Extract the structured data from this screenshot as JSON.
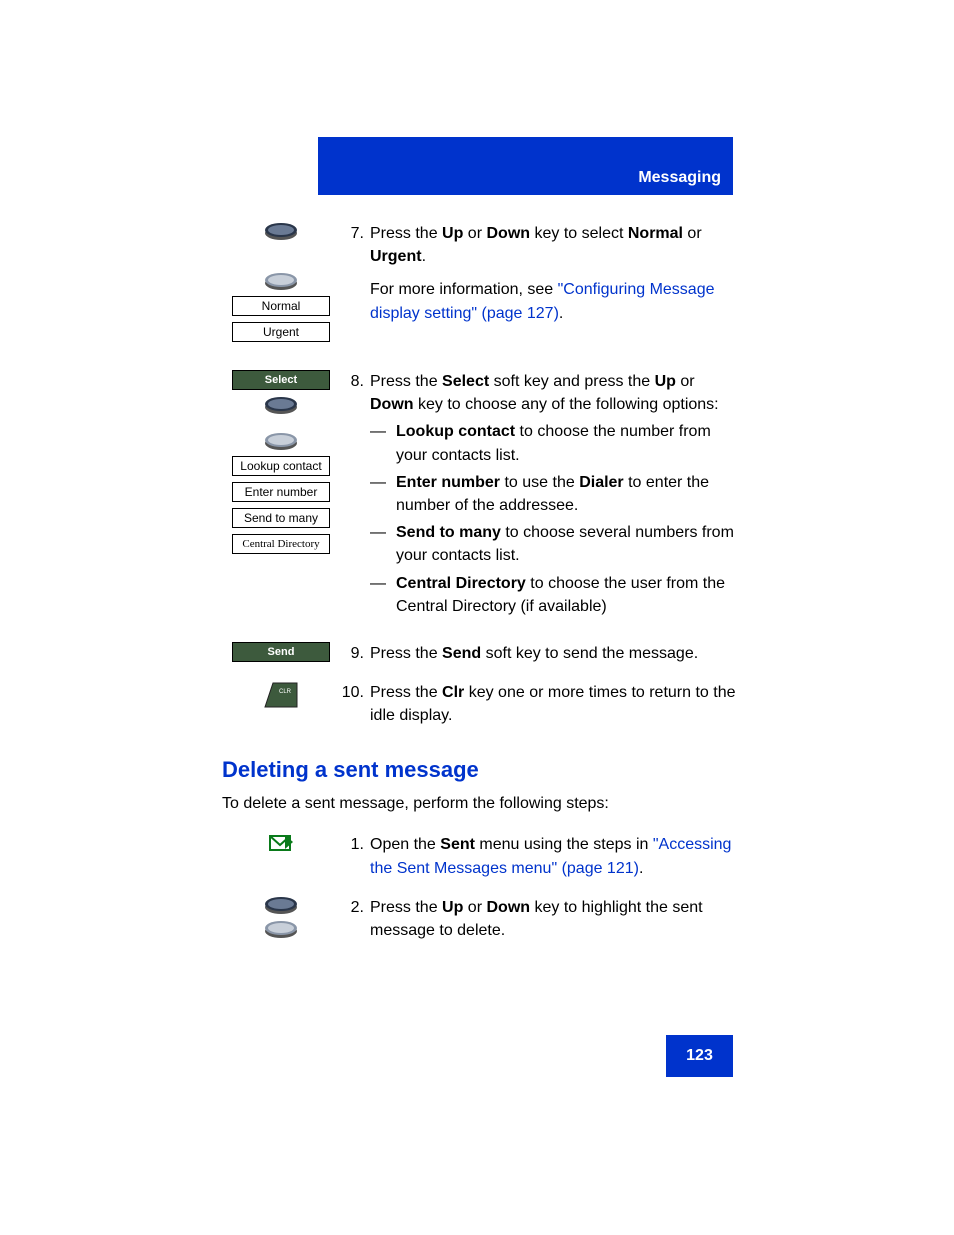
{
  "header": {
    "title": "Messaging"
  },
  "step7": {
    "num": "7.",
    "text_a": "Press the ",
    "up": "Up",
    "text_b": " or ",
    "down": "Down",
    "text_c": " key to select ",
    "normal": "Normal",
    "text_d": " or ",
    "urgent": "Urgent",
    "text_e": ".",
    "info_a": "For more information, see ",
    "info_link": "\"Configuring Message display setting\" (page 127)",
    "info_b": ".",
    "box_normal": "Normal",
    "box_urgent": "Urgent"
  },
  "step8": {
    "num": "8.",
    "text_a": "Press the ",
    "select": "Select",
    "text_b": " soft key and press the ",
    "up": "Up",
    "text_c": " or ",
    "down": "Down",
    "text_d": " key to choose any of the following options:",
    "opt1_b": "Lookup contact",
    "opt1_t": " to choose the number from your contacts list.",
    "opt2_b": "Enter number",
    "opt2_m": " to use the ",
    "opt2_d": "Dialer",
    "opt2_t": " to enter the number of the addressee.",
    "opt3_b": "Send to many",
    "opt3_t": " to choose several numbers from your contacts list.",
    "opt4_b": "Central Directory",
    "opt4_t": " to choose the user from the Central Directory (if available)",
    "box_select": "Select",
    "box_lookup": "Lookup contact",
    "box_enter": "Enter number",
    "box_many": "Send to many",
    "box_cd": "Central Directory"
  },
  "step9": {
    "num": "9.",
    "text_a": "Press the ",
    "send": "Send",
    "text_b": " soft key to send the message.",
    "box_send": "Send"
  },
  "step10": {
    "num": "10.",
    "text_a": "Press the ",
    "clr": "Clr",
    "text_b": " key one or more times to return to the idle display."
  },
  "section2": {
    "title": "Deleting a sent message",
    "intro": "To delete a sent message, perform the following steps:",
    "s1": {
      "num": "1.",
      "text_a": "Open the ",
      "sent": "Sent",
      "text_b": " menu using the steps in ",
      "link": "\"Accessing the Sent Messages menu\" (page 121)",
      "text_c": "."
    },
    "s2": {
      "num": "2.",
      "text_a": "Press the ",
      "up": "Up",
      "text_b": " or ",
      "down": "Down",
      "text_c": " key to highlight the sent message to delete."
    }
  },
  "footer": {
    "page": "123"
  },
  "colors": {
    "accent": "#0033cc"
  }
}
